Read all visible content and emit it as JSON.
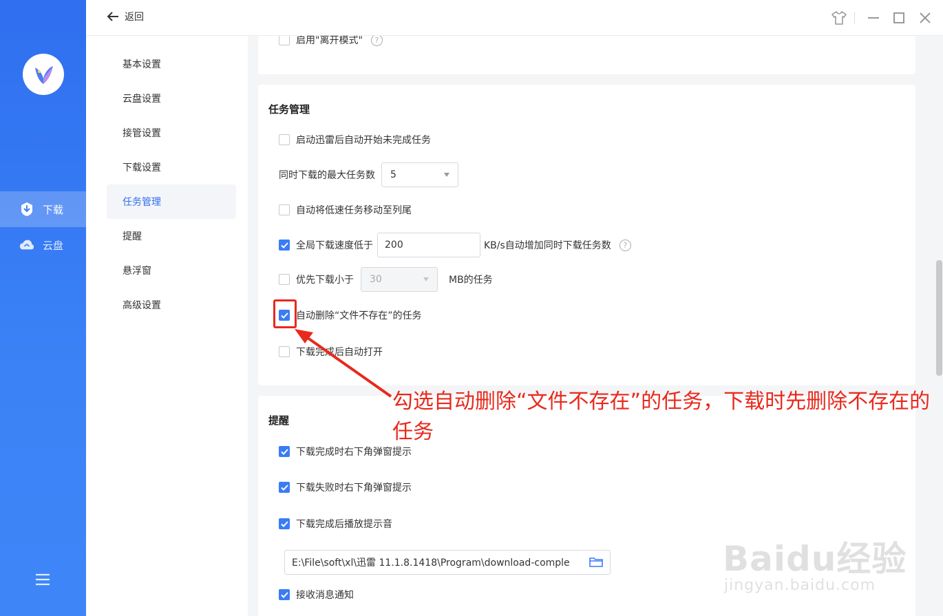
{
  "rail": {
    "items": [
      {
        "label": "下载",
        "icon": "download-shield-icon",
        "active": true
      },
      {
        "label": "云盘",
        "icon": "cloud-icon",
        "active": false
      }
    ]
  },
  "header": {
    "back_label": "返回"
  },
  "nav": {
    "items": [
      {
        "label": "基本设置"
      },
      {
        "label": "云盘设置"
      },
      {
        "label": "接管设置"
      },
      {
        "label": "下载设置"
      },
      {
        "label": "任务管理",
        "active": true
      },
      {
        "label": "提醒"
      },
      {
        "label": "悬浮窗"
      },
      {
        "label": "高级设置"
      }
    ]
  },
  "top_card": {
    "leave_mode_label": "启用\"离开模式\""
  },
  "task_mgmt": {
    "title": "任务管理",
    "auto_start_label": "启动迅雷后自动开始未完成任务",
    "max_tasks_label": "同时下载的最大任务数",
    "max_tasks_value": "5",
    "move_slow_label": "自动将低速任务移动至列尾",
    "speed_label": "全局下载速度低于",
    "speed_value": "200",
    "speed_suffix": "KB/s自动增加同时下载任务数",
    "prefer_small_label": "优先下载小于",
    "prefer_small_value": "30",
    "prefer_small_suffix": "MB的任务",
    "auto_delete_label": "自动删除“文件不存在”的任务",
    "auto_open_label": "下载完成后自动打开"
  },
  "remind": {
    "title": "提醒",
    "complete_popup_label": "下载完成时右下角弹窗提示",
    "fail_popup_label": "下载失败时右下角弹窗提示",
    "sound_label": "下载完成后播放提示音",
    "sound_path": "E:\\File\\soft\\xl\\迅雷 11.1.8.1418\\Program\\download-comple",
    "message_label": "接收消息通知"
  },
  "annotation": {
    "text": "勾选自动删除“文件不存在”的任务，下载时先删除不存在的任务",
    "color": "#e8291c"
  },
  "watermark": {
    "main": "Baidu经验",
    "sub": "jingyan.baidu.com"
  },
  "colors": {
    "accent": "#3a7cf5",
    "rail": "#3b82f6"
  }
}
